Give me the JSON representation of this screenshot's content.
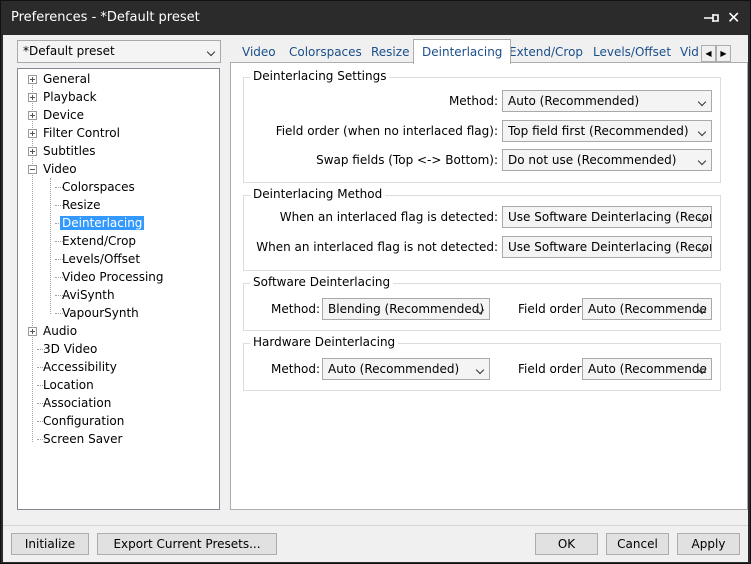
{
  "window": {
    "title": "Preferences - *Default preset"
  },
  "preset": {
    "value": "*Default preset"
  },
  "tree": {
    "general": "General",
    "playback": "Playback",
    "device": "Device",
    "filter_control": "Filter Control",
    "subtitles": "Subtitles",
    "video": "Video",
    "video_children": [
      "Colorspaces",
      "Resize",
      "Deinterlacing",
      "Extend/Crop",
      "Levels/Offset",
      "Video Processing",
      "AviSynth",
      "VapourSynth"
    ],
    "audio": "Audio",
    "three_d_video": "3D Video",
    "accessibility": "Accessibility",
    "location": "Location",
    "association": "Association",
    "configuration": "Configuration",
    "screen_saver": "Screen Saver",
    "selected": "Deinterlacing"
  },
  "tabs": [
    "Video",
    "Colorspaces",
    "Resize",
    "Deinterlacing",
    "Extend/Crop",
    "Levels/Offset",
    "Vid"
  ],
  "active_tab": "Deinterlacing",
  "deinterlacing_settings": {
    "title": "Deinterlacing Settings",
    "method_label": "Method:",
    "method_value": "Auto (Recommended)",
    "field_order_label": "Field order (when no interlaced flag):",
    "field_order_value": "Top field first (Recommended)",
    "swap_label": "Swap fields (Top <-> Bottom):",
    "swap_value": "Do not use (Recommended)"
  },
  "deinterlacing_method": {
    "title": "Deinterlacing Method",
    "flag_detected_label": "When an interlaced flag is detected:",
    "flag_detected_value": "Use Software Deinterlacing (Recom",
    "flag_not_detected_label": "When an interlaced flag is not detected:",
    "flag_not_detected_value": "Use Software Deinterlacing (Recom"
  },
  "software_deinterlacing": {
    "title": "Software Deinterlacing",
    "method_label": "Method:",
    "method_value": "Blending (Recommended)",
    "field_order_label": "Field order:",
    "field_order_value": "Auto (Recommende"
  },
  "hardware_deinterlacing": {
    "title": "Hardware Deinterlacing",
    "method_label": "Method:",
    "method_value": "Auto (Recommended)",
    "field_order_label": "Field order:",
    "field_order_value": "Auto (Recommende"
  },
  "buttons": {
    "initialize": "Initialize",
    "export": "Export Current Presets...",
    "ok": "OK",
    "cancel": "Cancel",
    "apply": "Apply"
  },
  "icons": {
    "pin": "pin-icon",
    "close": "close-icon"
  },
  "colors": {
    "titlebar": "#2b2b2b",
    "selection": "#3399ff",
    "tab_text": "#1a4f8b"
  }
}
